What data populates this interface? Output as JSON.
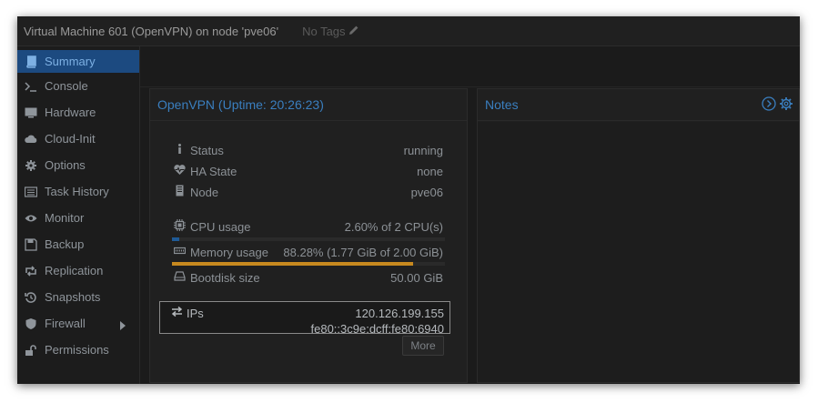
{
  "window": {
    "title": "Virtual Machine 601 (OpenVPN) on node 'pve06'",
    "tags_label": "No Tags"
  },
  "sidebar": {
    "items": [
      {
        "label": "Summary",
        "icon": "book-icon",
        "active": true
      },
      {
        "label": "Console",
        "icon": "terminal-icon"
      },
      {
        "label": "Hardware",
        "icon": "monitor-icon"
      },
      {
        "label": "Cloud-Init",
        "icon": "cloud-icon"
      },
      {
        "label": "Options",
        "icon": "gear-icon"
      },
      {
        "label": "Task History",
        "icon": "list-icon"
      },
      {
        "label": "Monitor",
        "icon": "eye-icon"
      },
      {
        "label": "Backup",
        "icon": "floppy-icon"
      },
      {
        "label": "Replication",
        "icon": "retweet-icon"
      },
      {
        "label": "Snapshots",
        "icon": "history-icon"
      },
      {
        "label": "Firewall",
        "icon": "shield-icon",
        "has_submenu": true
      },
      {
        "label": "Permissions",
        "icon": "unlock-icon"
      }
    ]
  },
  "status_panel": {
    "title": "OpenVPN (Uptime: 20:26:23)",
    "status": {
      "label": "Status",
      "value": "running"
    },
    "ha_state": {
      "label": "HA State",
      "value": "none"
    },
    "node": {
      "label": "Node",
      "value": "pve06"
    },
    "cpu": {
      "label": "CPU usage",
      "value": "2.60% of 2 CPU(s)",
      "fraction": 0.026
    },
    "memory": {
      "label": "Memory usage",
      "value": "88.28% (1.77 GiB of 2.00 GiB)",
      "fraction": 0.8828
    },
    "bootdisk": {
      "label": "Bootdisk size",
      "value": "50.00 GiB"
    },
    "ips": {
      "label": "IPs",
      "values": [
        "120.126.199.155",
        "fe80::3c9e:dcff:fe80:6940"
      ]
    },
    "more_label": "More"
  },
  "notes_panel": {
    "title": "Notes"
  },
  "colors": {
    "accent": "#3a7fc0",
    "active_nav_bg": "#1c4a80",
    "cpu_bar": "#1f5a96",
    "memory_bar": "#c7891f"
  }
}
